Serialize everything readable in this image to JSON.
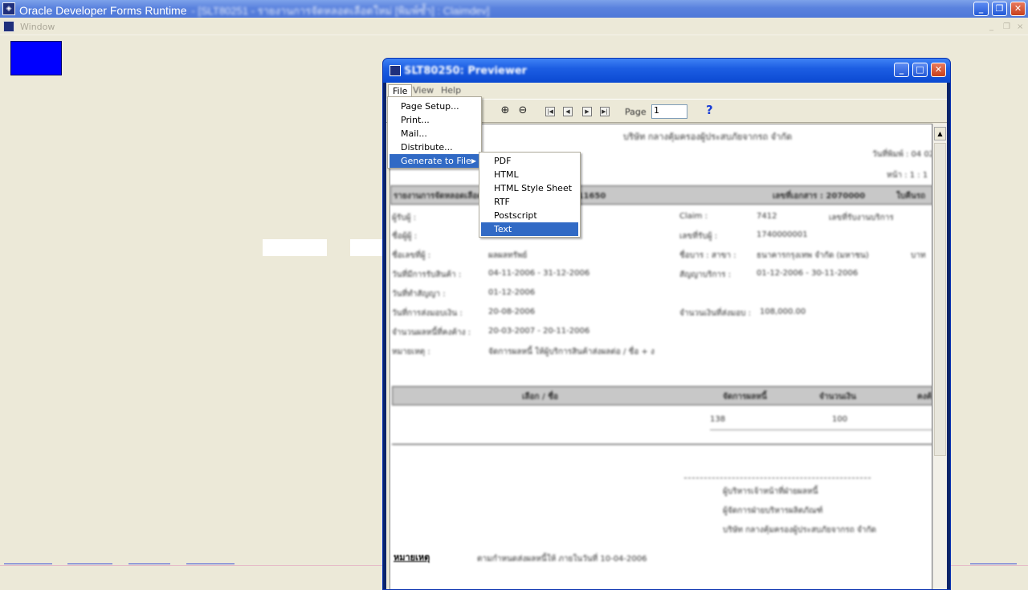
{
  "app": {
    "title": "Oracle Developer Forms Runtime",
    "title_suffix": "- [SLT80251 - รายงานการจัดหลอดเลือดใหม่ [พิมพ์ซ้ำ] : Claimdev]",
    "menu_window": "Window",
    "mdi_controls": [
      "_",
      "❐",
      "×"
    ]
  },
  "previewer": {
    "title": "SLT80250: Previewer",
    "menu": {
      "file": "File",
      "view": "View",
      "help": "Help"
    },
    "toolbar": {
      "page_label": "Page",
      "page_value": "1"
    },
    "file_menu": [
      {
        "label": "Page Setup..."
      },
      {
        "label": "Print..."
      },
      {
        "label": "Mail..."
      },
      {
        "label": "Distribute..."
      },
      {
        "label": "Generate to File"
      }
    ],
    "generate_submenu": [
      "PDF",
      "HTML",
      "HTML Style Sheet",
      "RTF",
      "Postscript",
      "Text"
    ],
    "selected_item": "Text"
  },
  "report": {
    "heading": "บริษัท กลางคุ้มครองผู้ประสบภัยจากรถ จำกัด",
    "page_info": [
      "วันที่พิมพ์ : 04 02",
      "หน้า : 1 : 1"
    ],
    "band_title": "รายงานการจัดหลอดเลือดใหม่ สำหรับบริการ Claim 11650",
    "band_right": [
      "เลขที่เอกสาร : 2070000",
      "ใบคืนรถ"
    ],
    "rows": [
      [
        "ผู้รับผู้ :",
        "",
        "Claim :",
        "7412",
        "เลขที่รับงานบริการ"
      ],
      [
        "ชื่อผู้ผู้ :",
        "",
        "เลขที่รับผู้ :",
        "1740000001",
        ""
      ],
      [
        "ชื่อเลขที่ผู้ :",
        "ผลผลทรัพย์",
        "ชื่อบาร : สาขา :",
        "ธนาคารกรุงเทพ จำกัด (มหาชน)",
        "บาท"
      ],
      [
        "วันที่มีการรับสินค้า :",
        "04-11-2006  -  31-12-2006",
        "สัญญาบริการ :",
        "01-12-2006  -  30-11-2006",
        ""
      ],
      [
        "วันที่ทำสัญญา :",
        "01-12-2006",
        "",
        "",
        ""
      ],
      [
        "วันที่การส่งมอบเงิน :",
        "20-08-2006",
        "จำนวนเงินที่ส่งมอบ :",
        "108,000.00",
        ""
      ],
      [
        "จำนวนผลหนี้ที่คงค้าง :",
        "20-03-2007  -  20-11-2006",
        "",
        "",
        ""
      ],
      [
        "หมายเหตุ :",
        "จัดการผลหนี้ ให้ผู้บริการสินค้าส่งผลต่อ / ชื่อ + ง",
        "",
        "",
        ""
      ]
    ],
    "table_headers": [
      "เลือก / ชื่อ",
      "จัดการผลหนี้",
      "จำนวนเงิน",
      "คงค้าง"
    ],
    "table_values": [
      "138",
      "100"
    ],
    "signatures": [
      "ผู้บริหารเจ้าหน้าที่ฝ่ายผลหนี้",
      "ผู้จัดการฝ่ายบริหารผลิตภัณฑ์",
      "บริษัท กลางคุ้มครองผู้ประสบภัยจากรถ จำกัด"
    ],
    "remark_label": "หมายเหตุ",
    "remark_text": "ตามกำหนดส่งผลหนี้ให้ ภายในวันที่ 10-04-2006"
  }
}
